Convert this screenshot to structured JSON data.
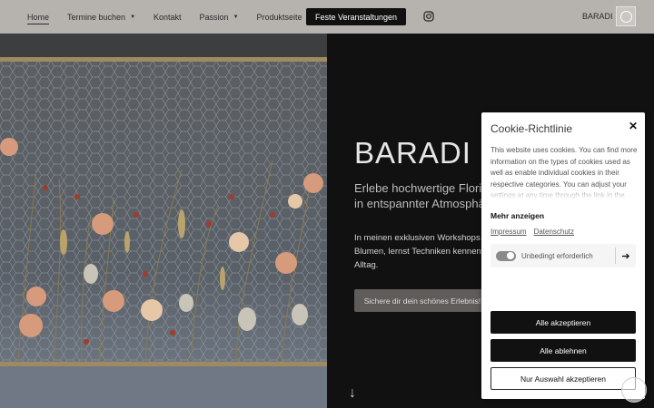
{
  "nav": {
    "items": [
      {
        "label": "Home",
        "active": true,
        "dropdown": false
      },
      {
        "label": "Termine buchen",
        "active": false,
        "dropdown": true
      },
      {
        "label": "Kontakt",
        "active": false,
        "dropdown": false
      },
      {
        "label": "Passion",
        "active": false,
        "dropdown": true
      },
      {
        "label": "Produktseite",
        "active": false,
        "dropdown": false
      }
    ],
    "cta_label": "Feste Veranstaltungen",
    "instagram_icon": "instagram-icon",
    "brand": "BARADI"
  },
  "hero": {
    "title": "BARADI",
    "subtitle_line1": "Erlebe hochwertige Florist",
    "subtitle_line2": "in entspannter Atmosphäre",
    "text_line1": "In meinen exklusiven Workshops arb",
    "text_line2": "Blumen, lernst Techniken kennen un",
    "text_line3": "Alltag.",
    "cta_label": "Sichere dir dein schönes Erlebnis!",
    "scroll_icon": "arrow-down-icon"
  },
  "cookie": {
    "title": "Cookie-Richtlinie",
    "close_icon": "close-icon",
    "text": "This website uses cookies. You can find more information on the types of cookies used as well as enable individual cookies in their respective categories. You can adjust your settings at any time through the link in the",
    "more_label": "Mehr anzeigen",
    "impressum": "Impressum",
    "datenschutz": "Datenschutz",
    "consent_label": "Unbedingt erforderlich",
    "consent_enabled": true,
    "accept_all": "Alle akzeptieren",
    "reject_all": "Alle ablehnen",
    "accept_selection": "Nur Auswahl akzeptieren"
  },
  "colors": {
    "header_bg": "#b6b2ae",
    "page_bg": "#111111",
    "cta_bg": "#5f5c59"
  }
}
